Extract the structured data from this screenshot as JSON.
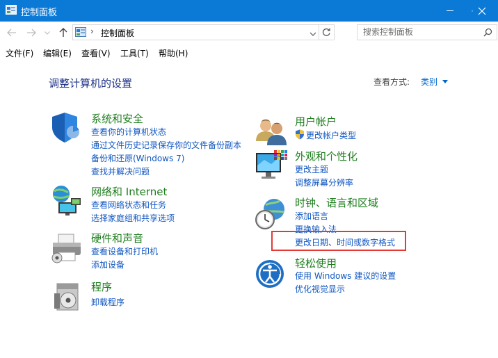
{
  "window": {
    "title": "控制面板",
    "controls": {
      "minimize": "minimize",
      "maximize": "maximize",
      "close": "close"
    }
  },
  "address_bar": {
    "breadcrumb_separator": "›",
    "breadcrumb": "控制面板",
    "search_placeholder": "搜索控制面板"
  },
  "menu": {
    "items": [
      "文件(F)",
      "编辑(E)",
      "查看(V)",
      "工具(T)",
      "帮助(H)"
    ]
  },
  "main": {
    "title": "调整计算机的设置",
    "view_by_label": "查看方式:",
    "view_by_value": "类别",
    "categories": [
      {
        "icon": "shield-icon",
        "title": "系统和安全",
        "links": [
          "查看你的计算机状态",
          "通过文件历史记录保存你的文件备份副本",
          "备份和还原(Windows 7)",
          "查找并解决问题"
        ]
      },
      {
        "icon": "network-icon",
        "title": "网络和 Internet",
        "links": [
          "查看网络状态和任务",
          "选择家庭组和共享选项"
        ]
      },
      {
        "icon": "printer-icon",
        "title": "硬件和声音",
        "links": [
          "查看设备和打印机",
          "添加设备"
        ]
      },
      {
        "icon": "programs-icon",
        "title": "程序",
        "links": [
          "卸载程序"
        ]
      },
      {
        "icon": "users-icon",
        "title": "用户帐户",
        "links": [
          "更改帐户类型"
        ]
      },
      {
        "icon": "monitor-icon",
        "title": "外观和个性化",
        "links": [
          "更改主题",
          "调整屏幕分辨率"
        ]
      },
      {
        "icon": "clock-globe-icon",
        "title": "时钟、语言和区域",
        "links": [
          "添加语言",
          "更换输入法",
          "更改日期、时间或数字格式"
        ]
      },
      {
        "icon": "ease-of-access-icon",
        "title": "轻松使用",
        "links": [
          "使用 Windows 建议的设置",
          "优化视觉显示"
        ]
      }
    ]
  },
  "colors": {
    "titlebar": "#0b7ad7",
    "category_title": "#1e7e1e",
    "link": "#0f56c2",
    "page_title": "#1e3287",
    "highlight_box": "#e53935"
  }
}
